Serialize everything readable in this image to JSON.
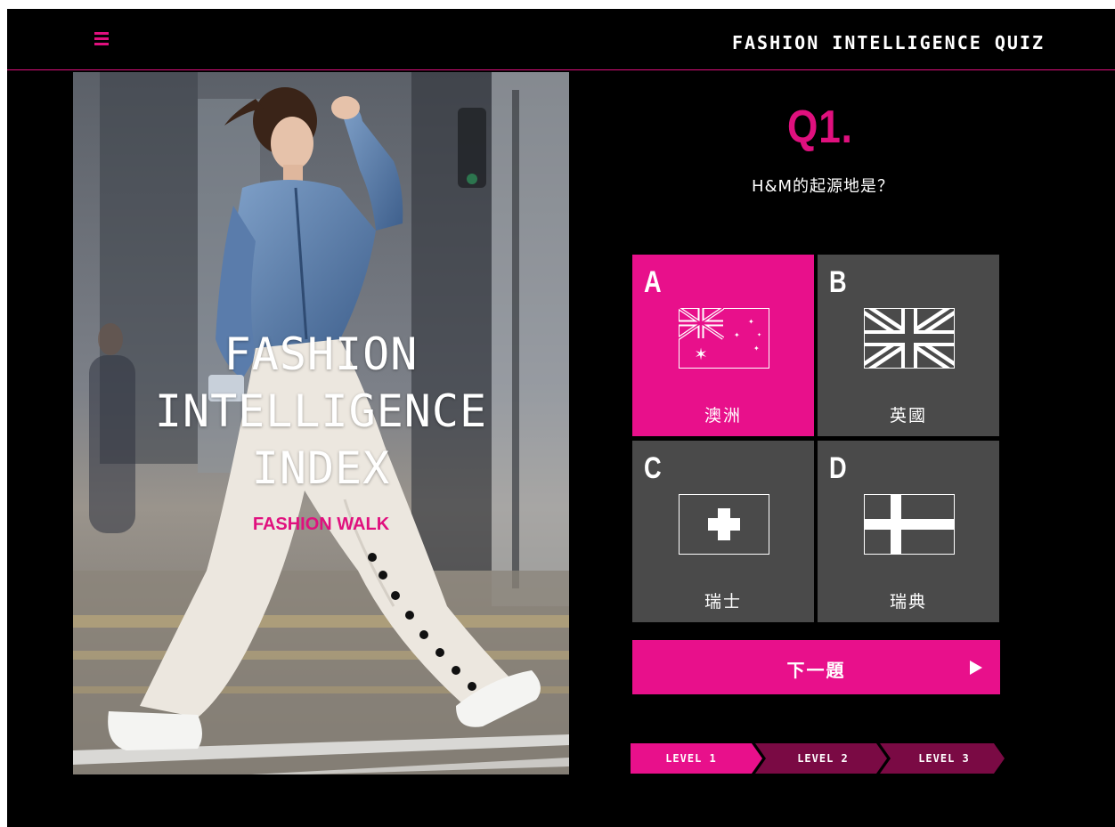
{
  "header": {
    "title": "FASHION INTELLIGENCE QUIZ",
    "menu_icon": "hamburger-menu-icon"
  },
  "hero": {
    "title_line1": "FASHION",
    "title_line2": "INTELLIGENCE",
    "title_line3": "INDEX",
    "subtitle": "FASHION WALK"
  },
  "question": {
    "number": "Q1.",
    "text": "H&M的起源地是？"
  },
  "options": [
    {
      "letter": "A",
      "label": "澳洲",
      "flag": "australia-flag-icon",
      "selected": true
    },
    {
      "letter": "B",
      "label": "英國",
      "flag": "uk-flag-icon",
      "selected": false
    },
    {
      "letter": "C",
      "label": "瑞士",
      "flag": "switzerland-flag-icon",
      "selected": false
    },
    {
      "letter": "D",
      "label": "瑞典",
      "flag": "sweden-flag-icon",
      "selected": false
    }
  ],
  "next_button": {
    "label": "下一題",
    "icon": "play-arrow-icon"
  },
  "levels": [
    {
      "label": "LEVEL 1",
      "active": true
    },
    {
      "label": "LEVEL 2",
      "active": false
    },
    {
      "label": "LEVEL 3",
      "active": false
    }
  ],
  "colors": {
    "accent": "#e8108b",
    "option_bg": "#4a4a4a",
    "level_inactive": "#7a0a44",
    "background": "#000000"
  }
}
